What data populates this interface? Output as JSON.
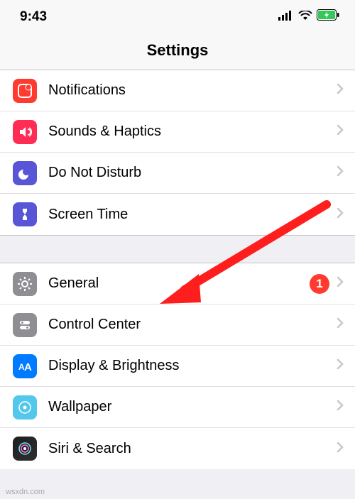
{
  "status": {
    "time": "9:43"
  },
  "nav": {
    "title": "Settings"
  },
  "group1": {
    "notifications": "Notifications",
    "sounds": "Sounds & Haptics",
    "dnd": "Do Not Disturb",
    "screenTime": "Screen Time"
  },
  "group2": {
    "general": "General",
    "generalBadge": "1",
    "controlCenter": "Control Center",
    "display": "Display & Brightness",
    "wallpaper": "Wallpaper",
    "siri": "Siri & Search"
  },
  "watermark": "wsxdn.com"
}
